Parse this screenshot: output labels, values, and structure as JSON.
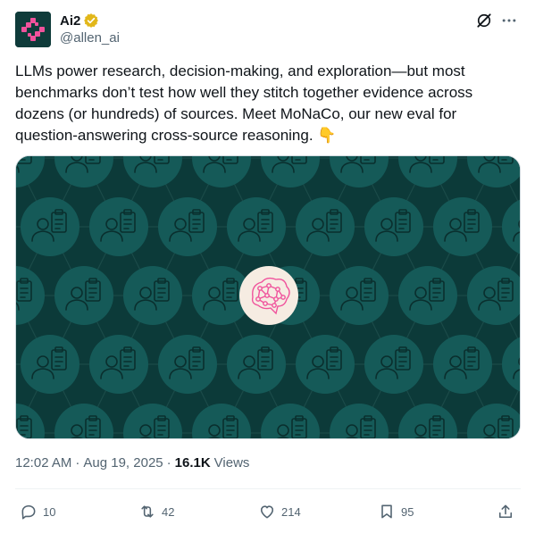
{
  "author": {
    "display_name": "Ai2",
    "handle": "@allen_ai",
    "verified": true,
    "avatar_icon": "ai2-logo-icon",
    "brand_color": "#f0529c"
  },
  "header_actions": {
    "grok_icon": "grok-icon",
    "more_icon": "more-dots-icon"
  },
  "tweet": {
    "text": "LLMs power research, decision-making, and exploration—but most benchmarks don’t test how well they stitch together evidence across dozens (or hundreds) of sources. Meet MoNaCo, our new eval for question-answering cross-source reasoning. 👇"
  },
  "media": {
    "description_icon": "brain-network-icon",
    "background_color": "#0c3a39",
    "tile_color": "#155a58",
    "center_color": "#f6ece2",
    "brain_color": "#f0529c"
  },
  "meta": {
    "time": "12:02 AM",
    "separator": "·",
    "date": "Aug 19, 2025",
    "separator2": "·",
    "views_count": "16.1K",
    "views_label": "Views"
  },
  "engagement": {
    "replies": "10",
    "reposts": "42",
    "likes": "214",
    "bookmarks": "95"
  }
}
